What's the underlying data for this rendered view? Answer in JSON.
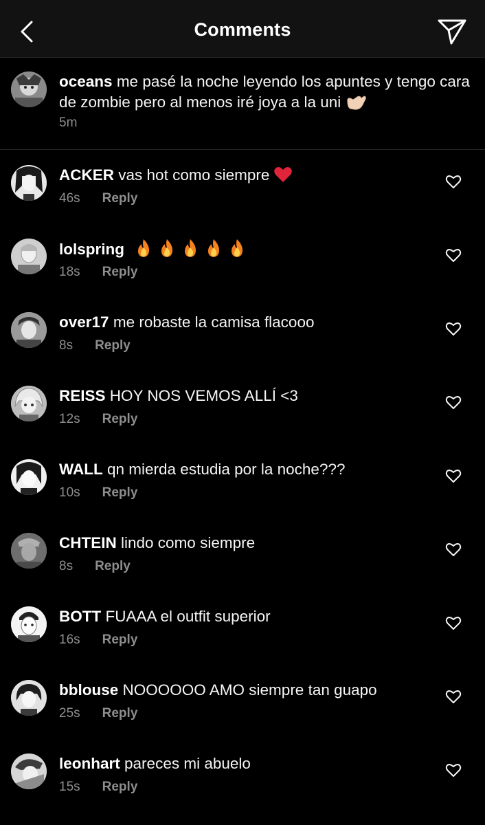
{
  "header": {
    "title": "Comments",
    "back_icon": "chevron-left-icon",
    "send_icon": "paper-plane-icon"
  },
  "caption": {
    "username": "oceans",
    "text": "me pasé la noche leyendo los apuntes y tengo cara de zombie pero al menos iré joya a la uni",
    "emoji": "call-me-hand-emoji",
    "time": "5m"
  },
  "reply_label": "Reply",
  "comments": [
    {
      "username": "ACKER",
      "text": "vas hot como siempre",
      "emoji": "red-heart-emoji",
      "time": "46s"
    },
    {
      "username": "lolspring",
      "text": "",
      "emoji": "fire-emoji x5",
      "time": "18s"
    },
    {
      "username": "over17",
      "text": "me robaste la camisa flacooo",
      "time": "8s"
    },
    {
      "username": "REISS",
      "text": "HOY NOS VEMOS ALLÍ <3",
      "time": "12s"
    },
    {
      "username": "WALL",
      "text": "qn mierda estudia por la noche???",
      "time": "10s"
    },
    {
      "username": "CHTEIN",
      "text": "lindo como siempre",
      "time": "8s"
    },
    {
      "username": "BOTT",
      "text": "FUAAA el outfit superior",
      "time": "16s"
    },
    {
      "username": "bblouse",
      "text": "NOOOOOO AMO siempre tan guapo",
      "time": "25s"
    },
    {
      "username": "leonhart",
      "text": "pareces mi abuelo",
      "time": "15s"
    }
  ],
  "colors": {
    "background": "#000000",
    "header_bg": "#121212",
    "secondary_text": "#8e8e8e",
    "divider": "#262626"
  }
}
